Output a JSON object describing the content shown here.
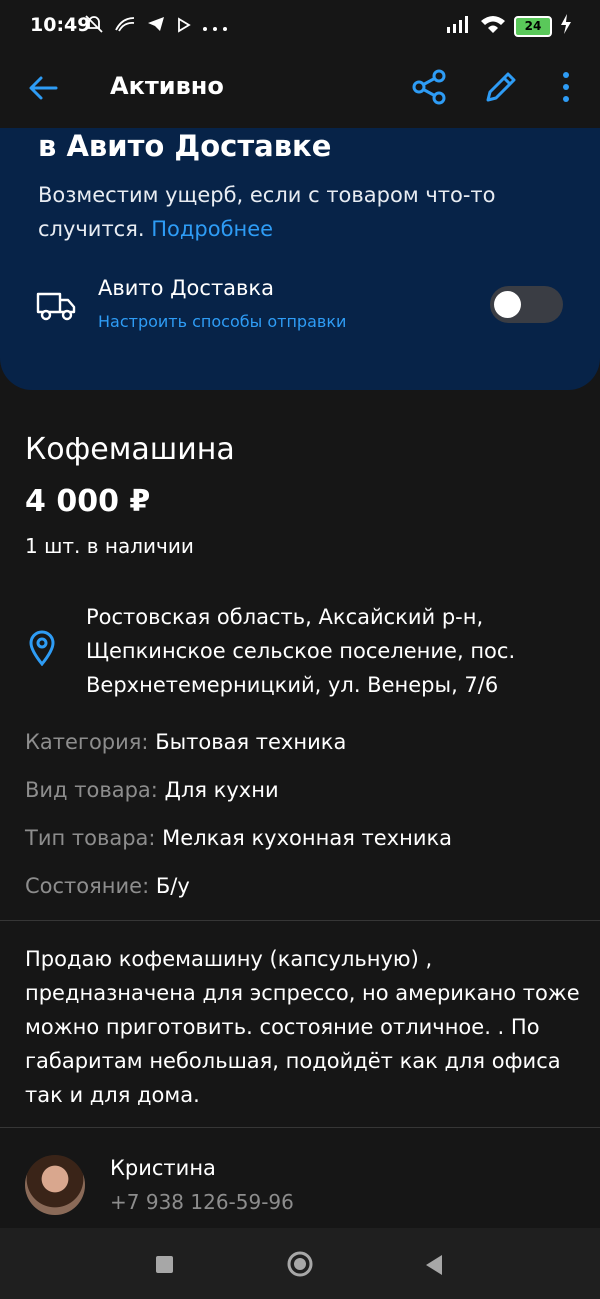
{
  "status_bar": {
    "time": "10:49",
    "battery": "24",
    "icons": [
      "mute-icon",
      "wave-icon",
      "telegram-icon",
      "play-icon",
      "more-dots-icon",
      "signal-icon",
      "wifi-icon",
      "battery-icon",
      "charging-icon"
    ]
  },
  "appbar": {
    "title": "Активно",
    "back_icon": "arrow-left-icon",
    "share_icon": "share-icon",
    "edit_icon": "pencil-icon",
    "more_icon": "kebab-icon"
  },
  "delivery": {
    "title": "в Авито Доставке",
    "description": "Возместим ущерб, если с товаром что-то случится.",
    "link": "Подробнее",
    "option_title": "Авито Доставка",
    "option_subtitle": "Настроить способы отправки",
    "toggle_on": false
  },
  "item": {
    "title": "Кофемашина",
    "price": "4 000 ₽",
    "stock": "1 шт. в наличии",
    "address": "Ростовская область, Аксайский р-н, Щепкинское сельское поселение, пос. Верхнетемерницкий, ул. Венеры, 7/6"
  },
  "params": [
    {
      "key": "Категория:",
      "value": "Бытовая техника"
    },
    {
      "key": "Вид товара:",
      "value": "Для кухни"
    },
    {
      "key": "Тип товара:",
      "value": "Мелкая кухонная техника"
    },
    {
      "key": "Состояние:",
      "value": "Б/у"
    }
  ],
  "description": "Продаю кофемашину (капсульную) , предназначена для эспрессо, но американо тоже можно приготовить. состояние отличное. . По габаритам небольшая, подойдёт как для офиса так и для дома.",
  "seller": {
    "name": "Кристина",
    "phone": "+7 938 126-59-96"
  },
  "colors": {
    "background": "#161616",
    "card": "#072348",
    "accent": "#2e9cf5",
    "muted": "#8d8d8d"
  }
}
